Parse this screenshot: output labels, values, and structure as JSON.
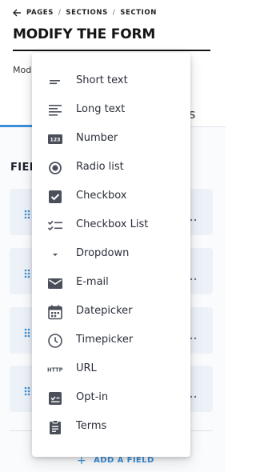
{
  "breadcrumb": {
    "items": [
      "PAGES",
      "SECTIONS",
      "SECTION"
    ],
    "separator": "/"
  },
  "page": {
    "title": "MODIFY THE FORM",
    "subtitle_fragment": "Mod",
    "tab_fragment": "s"
  },
  "section": {
    "label_fragment": "FIEL"
  },
  "add_field_label": "ADD A FIELD",
  "colors": {
    "accent": "#3b8fd9",
    "row_bg": "#edf2f8",
    "text": "#1f2430"
  },
  "menu": {
    "items": [
      {
        "label": "Short text",
        "icon": "short-text-icon"
      },
      {
        "label": "Long text",
        "icon": "long-text-icon"
      },
      {
        "label": "Number",
        "icon": "number-icon"
      },
      {
        "label": "Radio list",
        "icon": "radio-icon"
      },
      {
        "label": "Checkbox",
        "icon": "checkbox-icon"
      },
      {
        "label": "Checkbox List",
        "icon": "checkbox-list-icon"
      },
      {
        "label": "Dropdown",
        "icon": "dropdown-icon"
      },
      {
        "label": "E-mail",
        "icon": "email-icon"
      },
      {
        "label": "Datepicker",
        "icon": "calendar-icon"
      },
      {
        "label": "Timepicker",
        "icon": "clock-icon"
      },
      {
        "label": "URL",
        "icon": "url-icon",
        "icon_text": "HTTP"
      },
      {
        "label": "Opt-in",
        "icon": "opt-in-icon"
      },
      {
        "label": "Terms",
        "icon": "terms-icon"
      }
    ]
  }
}
